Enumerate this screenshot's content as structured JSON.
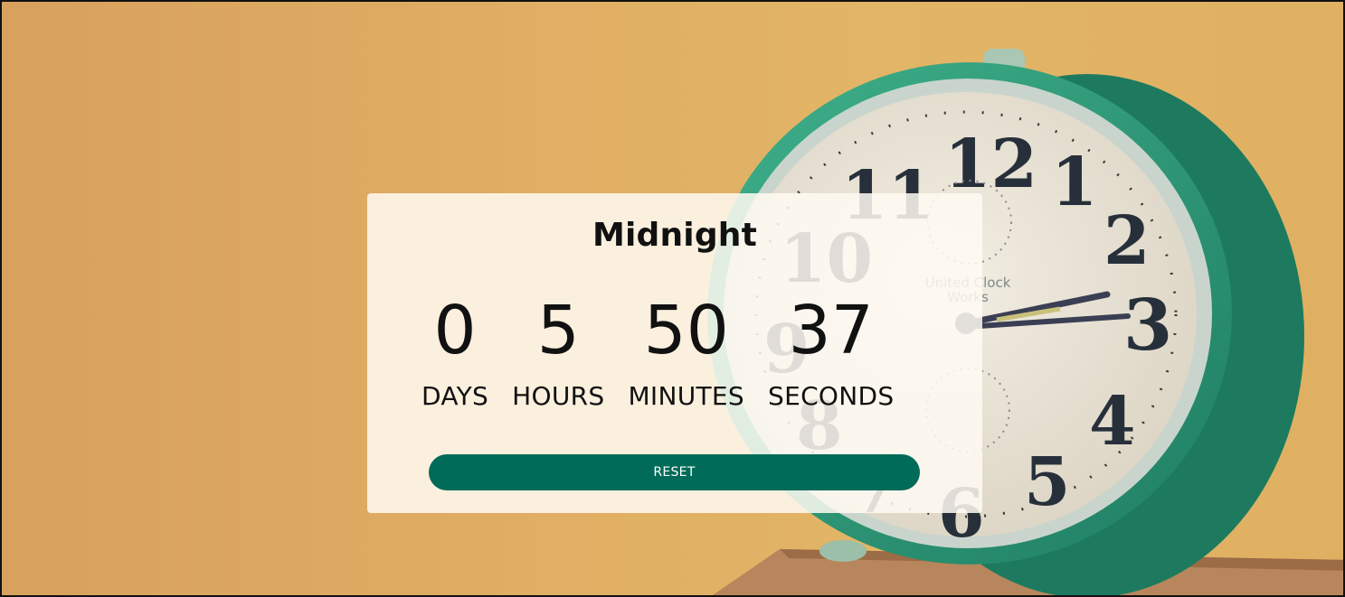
{
  "countdown": {
    "title": "Midnight",
    "units": [
      {
        "value": "0",
        "label": "DAYS"
      },
      {
        "value": "5",
        "label": "HOURS"
      },
      {
        "value": "50",
        "label": "MINUTES"
      },
      {
        "value": "37",
        "label": "SECONDS"
      }
    ],
    "reset_label": "RESET"
  },
  "background": {
    "image": "alarm-clock-photo",
    "colors": {
      "backdrop": "#dfac63",
      "clock_body": "#2a9d78",
      "button": "#006b58"
    },
    "clock_numerals": [
      "12",
      "1",
      "2",
      "3",
      "4",
      "5",
      "6",
      "7",
      "8",
      "9",
      "10",
      "11"
    ],
    "clock_brand_line1": "United Clock",
    "clock_brand_line2": "Works"
  }
}
